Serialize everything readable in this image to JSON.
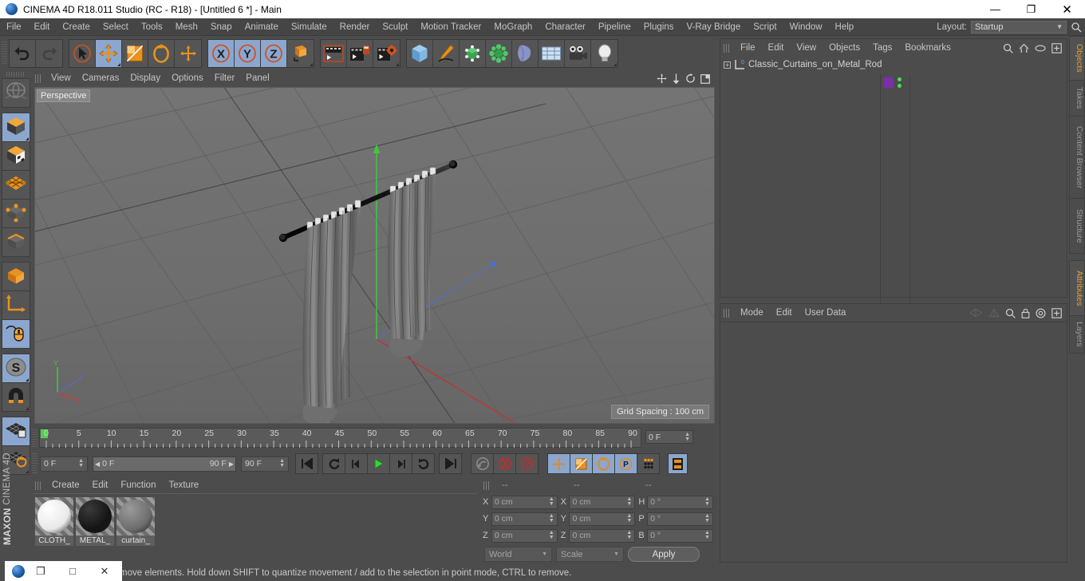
{
  "window": {
    "title": "CINEMA 4D R18.011 Studio (RC - R18) - [Untitled 6 *] - Main",
    "minimize": "—",
    "maximize": "❐",
    "close": "✕"
  },
  "menubar": {
    "items": [
      "File",
      "Edit",
      "Create",
      "Select",
      "Tools",
      "Mesh",
      "Snap",
      "Animate",
      "Simulate",
      "Render",
      "Sculpt",
      "Motion Tracker",
      "MoGraph",
      "Character",
      "Pipeline",
      "Plugins",
      "V-Ray Bridge",
      "Script",
      "Window",
      "Help"
    ],
    "layout_label": "Layout:",
    "layout_value": "Startup"
  },
  "toolbar": {
    "groups": [
      {
        "name": "undo-redo",
        "buttons": [
          {
            "icon": "undo-icon",
            "label": "Undo",
            "selected": false
          },
          {
            "icon": "redo-icon",
            "label": "Redo",
            "selected": false
          }
        ]
      },
      {
        "name": "transform-tools",
        "buttons": [
          {
            "icon": "select-cursor-icon",
            "label": "Live Selection",
            "selected": false
          },
          {
            "icon": "move-icon",
            "label": "Move",
            "selected": true
          },
          {
            "icon": "scale-icon",
            "label": "Scale",
            "selected": false
          },
          {
            "icon": "rotate-icon",
            "label": "Rotate",
            "selected": false
          },
          {
            "icon": "axis-move-icon",
            "label": "Move Axis",
            "selected": false
          }
        ]
      },
      {
        "name": "axis-locks",
        "buttons": [
          {
            "icon": "x-axis-icon",
            "label": "X",
            "selected": true
          },
          {
            "icon": "y-axis-icon",
            "label": "Y",
            "selected": true
          },
          {
            "icon": "z-axis-icon",
            "label": "Z",
            "selected": true
          },
          {
            "icon": "world-object-axis-icon",
            "label": "World/Object",
            "selected": false
          }
        ]
      },
      {
        "name": "render-tools",
        "buttons": [
          {
            "icon": "render-view-icon",
            "label": "Render View",
            "selected": false
          },
          {
            "icon": "render-picture-viewer-icon",
            "label": "Render to Picture Viewer",
            "selected": false
          },
          {
            "icon": "render-settings-icon",
            "label": "Edit Render Settings",
            "selected": false
          }
        ]
      },
      {
        "name": "create-objects",
        "buttons": [
          {
            "icon": "cube-primitive-icon",
            "label": "Cube",
            "selected": false
          },
          {
            "icon": "spline-pen-icon",
            "label": "Pen Spline",
            "selected": false
          },
          {
            "icon": "nurbs-icon",
            "label": "Subdivision Surface",
            "selected": false
          },
          {
            "icon": "mograph-icon",
            "label": "MoGraph",
            "selected": false
          },
          {
            "icon": "deformer-icon",
            "label": "Bend Deformer",
            "selected": false
          },
          {
            "icon": "scene-object-icon",
            "label": "Floor",
            "selected": false
          },
          {
            "icon": "camera-icon",
            "label": "Camera",
            "selected": false
          },
          {
            "icon": "light-icon",
            "label": "Light",
            "selected": false
          }
        ]
      }
    ]
  },
  "left_tools": {
    "buttons": [
      {
        "icon": "undo-view-icon",
        "label": "Undo View",
        "selected": false,
        "corner": false
      },
      {
        "icon": "model-mode-icon",
        "label": "Model Mode",
        "selected": true,
        "corner": true
      },
      {
        "icon": "texture-mode-icon",
        "label": "Texture Mode",
        "selected": false,
        "corner": false
      },
      {
        "icon": "polygon-mode-icon",
        "label": "Polygon Mode",
        "selected": false,
        "corner": false
      },
      {
        "icon": "point-mode-icon",
        "label": "Point Mode",
        "selected": false,
        "corner": false
      },
      {
        "icon": "edge-mode-icon",
        "label": "Edge Mode",
        "selected": false,
        "corner": false
      },
      {
        "icon": "object-axis-mode-icon",
        "label": "Enable Axis",
        "selected": false,
        "corner": false
      },
      {
        "icon": "axis-gizmo-icon",
        "label": "Object Axis",
        "selected": false,
        "corner": false
      },
      {
        "icon": "viewport-solo-icon",
        "label": "Viewport Solo",
        "selected": true,
        "corner": false
      },
      {
        "icon": "snap-s-icon",
        "label": "Enable Snap",
        "selected": true,
        "corner": true
      },
      {
        "icon": "magnet-icon",
        "label": "Magnet",
        "selected": false,
        "corner": true
      },
      {
        "icon": "workplane-lock-icon",
        "label": "Lock Workplane",
        "selected": true,
        "corner": false
      },
      {
        "icon": "workplane-rotate-icon",
        "label": "Planar Workplane",
        "selected": false,
        "corner": true
      }
    ],
    "brand_top": "MAXON",
    "brand_bottom": "CINEMA 4D"
  },
  "viewport": {
    "menus": [
      "View",
      "Cameras",
      "Display",
      "Options",
      "Filter",
      "Panel"
    ],
    "header_icons": [
      "viewport-move-icon",
      "viewport-scale-icon",
      "viewport-rotate-icon",
      "viewport-maximize-icon"
    ],
    "perspective_label": "Perspective",
    "grid_spacing": "Grid Spacing : 100 cm",
    "axis_labels": {
      "x": "X",
      "y": "Y",
      "z": "Z"
    },
    "axis_colors": {
      "x": "#d03a3a",
      "y": "#3ec93e",
      "z": "#4a6fe0"
    }
  },
  "timeline": {
    "ticks": [
      "0",
      "5",
      "10",
      "15",
      "20",
      "25",
      "30",
      "35",
      "40",
      "45",
      "50",
      "55",
      "60",
      "65",
      "70",
      "75",
      "80",
      "85",
      "90"
    ],
    "current_frame_field": "0 F",
    "playhead_frame": "0"
  },
  "playback": {
    "current_frame": "0 F",
    "range_start": "0 F",
    "range_end": "90 F",
    "end_frame": "90 F",
    "buttons": [
      {
        "icon": "go-to-start-icon",
        "label": "Go to Start",
        "selected": false
      },
      {
        "icon": "play-backwards-loop-icon",
        "label": "Play Backwards",
        "selected": false
      },
      {
        "icon": "previous-frame-icon",
        "label": "Previous Frame",
        "selected": false
      },
      {
        "icon": "play-forward-icon",
        "label": "Play Forward",
        "selected": false
      },
      {
        "icon": "next-frame-icon",
        "label": "Next Frame",
        "selected": false
      },
      {
        "icon": "play-loop-icon",
        "label": "Loop",
        "selected": false
      },
      {
        "icon": "go-to-end-icon",
        "label": "Go to End",
        "selected": false
      }
    ],
    "record_buttons": [
      {
        "icon": "autokey-key-icon",
        "label": "Record Active Objects",
        "selected": false
      },
      {
        "icon": "autokeying-icon",
        "label": "Autokeying",
        "selected": false
      },
      {
        "icon": "keyframe-selection-icon",
        "label": "Keyframe Selection",
        "selected": false
      }
    ],
    "param_buttons": [
      {
        "icon": "key-position-icon",
        "label": "Position",
        "selected": true
      },
      {
        "icon": "key-scale-icon",
        "label": "Scale",
        "selected": true
      },
      {
        "icon": "key-rotation-icon",
        "label": "Rotation",
        "selected": true
      },
      {
        "icon": "key-pla-icon",
        "label": "Point Level Animation",
        "selected": true
      },
      {
        "icon": "key-parameter-icon",
        "label": "Parameter",
        "selected": true
      }
    ],
    "timeline_toggle": {
      "icon": "timeline-strip-icon",
      "label": "Animation Layers",
      "selected": true
    }
  },
  "materials": {
    "menus": [
      "Create",
      "Edit",
      "Function",
      "Texture"
    ],
    "items": [
      {
        "name": "CLOTH_",
        "color": "#e8e8e8",
        "highlight": "#ffffff"
      },
      {
        "name": "METAL_",
        "color": "#141414",
        "highlight": "#3a3a3a"
      },
      {
        "name": "curtain_",
        "color": "#6d6d6d",
        "highlight": "#9a9a9a"
      }
    ]
  },
  "coordinates": {
    "headers": [
      "--",
      "--",
      "--"
    ],
    "rows": [
      {
        "pos_label": "X",
        "pos_value": "0 cm",
        "size_label": "X",
        "size_value": "0 cm",
        "rot_label": "H",
        "rot_value": "0 °"
      },
      {
        "pos_label": "Y",
        "pos_value": "0 cm",
        "size_label": "Y",
        "size_value": "0 cm",
        "rot_label": "P",
        "rot_value": "0 °"
      },
      {
        "pos_label": "Z",
        "pos_value": "0 cm",
        "size_label": "Z",
        "size_value": "0 cm",
        "rot_label": "B",
        "rot_value": "0 °"
      }
    ],
    "system": "World",
    "mode": "Scale",
    "apply": "Apply"
  },
  "object_manager": {
    "menus": [
      "File",
      "Edit",
      "View",
      "Objects",
      "Tags",
      "Bookmarks"
    ],
    "header_icons": [
      "search-icon",
      "home-icon",
      "eye-icon",
      "new-tab-icon"
    ],
    "objects": [
      {
        "name": "Classic_Curtains_on_Metal_Rod",
        "expandable": "+",
        "layer_color": "#7b2fa8",
        "tag_dots": 2
      }
    ]
  },
  "attributes": {
    "menus": [
      "Mode",
      "Edit",
      "User Data"
    ],
    "header_icons": [
      "prev-nav-icon",
      "next-nav-icon",
      "search-icon",
      "lock-icon",
      "target-icon",
      "new-tab-icon"
    ]
  },
  "right_tabs": {
    "top": [
      {
        "label": "Objects",
        "active": true
      },
      {
        "label": "Takes",
        "active": false
      },
      {
        "label": "Content Browser",
        "active": false
      },
      {
        "label": "Structure",
        "active": false
      }
    ],
    "bottom": [
      {
        "label": "Attributes",
        "active": true
      },
      {
        "label": "Layers",
        "active": false
      }
    ]
  },
  "statusbar": {
    "message": "move elements. Hold down SHIFT to quantize movement / add to the selection in point mode, CTRL to remove."
  },
  "taskwindow": {
    "restore": "❐",
    "maximize": "□",
    "close": "✕"
  }
}
